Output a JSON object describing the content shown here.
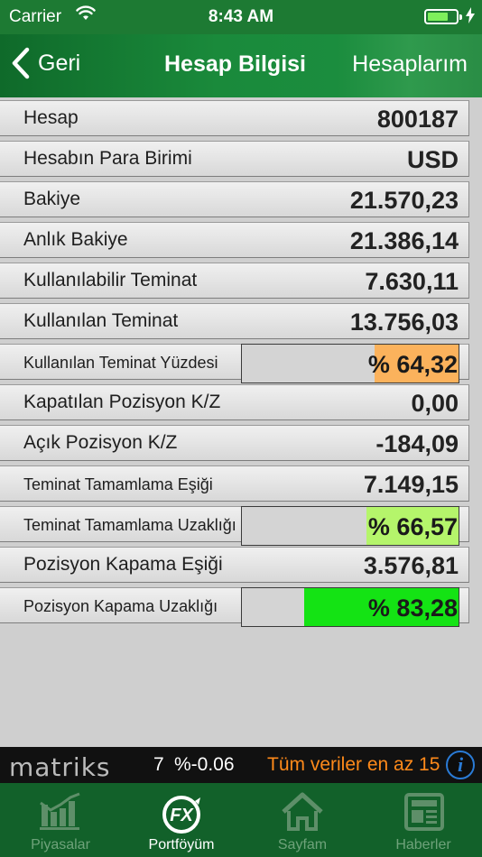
{
  "status_bar": {
    "carrier": "Carrier",
    "time": "8:43 AM"
  },
  "nav": {
    "back_label": "Geri",
    "title": "Hesap Bilgisi",
    "right_label": "Hesaplarım"
  },
  "rows": [
    {
      "label": "Hesap",
      "value": "800187"
    },
    {
      "label": "Hesabın Para Birimi",
      "value": "USD"
    },
    {
      "label": "Bakiye",
      "value": "21.570,23"
    },
    {
      "label": "Anlık Bakiye",
      "value": "21.386,14"
    },
    {
      "label": "Kullanılabilir Teminat",
      "value": "7.630,11"
    },
    {
      "label": "Kullanılan Teminat",
      "value": "13.756,03"
    },
    {
      "label": "Kullanılan Teminat Yüzdesi",
      "value": "% 64,32",
      "percent": 64.32,
      "color": "#fbb25c"
    },
    {
      "label": "Kapatılan Pozisyon K/Z",
      "value": "0,00"
    },
    {
      "label": "Açık Pozisyon K/Z",
      "value": "-184,09"
    },
    {
      "label": "Teminat Tamamlama Eşiği",
      "value": "7.149,15"
    },
    {
      "label": "Teminat Tamamlama Uzaklığı",
      "value": "% 66,57",
      "percent": 66.57,
      "color": "#b5f56b"
    },
    {
      "label": "Pozisyon Kapama Eşiği",
      "value": "3.576,81"
    },
    {
      "label": "Pozisyon Kapama Uzaklığı",
      "value": "% 83,28",
      "percent": 83.28,
      "color": "#14e314"
    }
  ],
  "ticker": {
    "brand": "matriks",
    "count": "7",
    "change": "%-0.06",
    "message": "Tüm veriler en az 15"
  },
  "tabs": [
    {
      "label": "Piyasalar",
      "icon": "chart-bars-icon",
      "active": false
    },
    {
      "label": "Portföyüm",
      "icon": "fx-logo-icon",
      "active": true
    },
    {
      "label": "Sayfam",
      "icon": "home-icon",
      "active": false
    },
    {
      "label": "Haberler",
      "icon": "newspaper-icon",
      "active": false
    }
  ],
  "colors": {
    "nav_green": "#1a8a3b",
    "tab_bar": "#12612a",
    "ticker_orange": "#ff8a1a"
  }
}
